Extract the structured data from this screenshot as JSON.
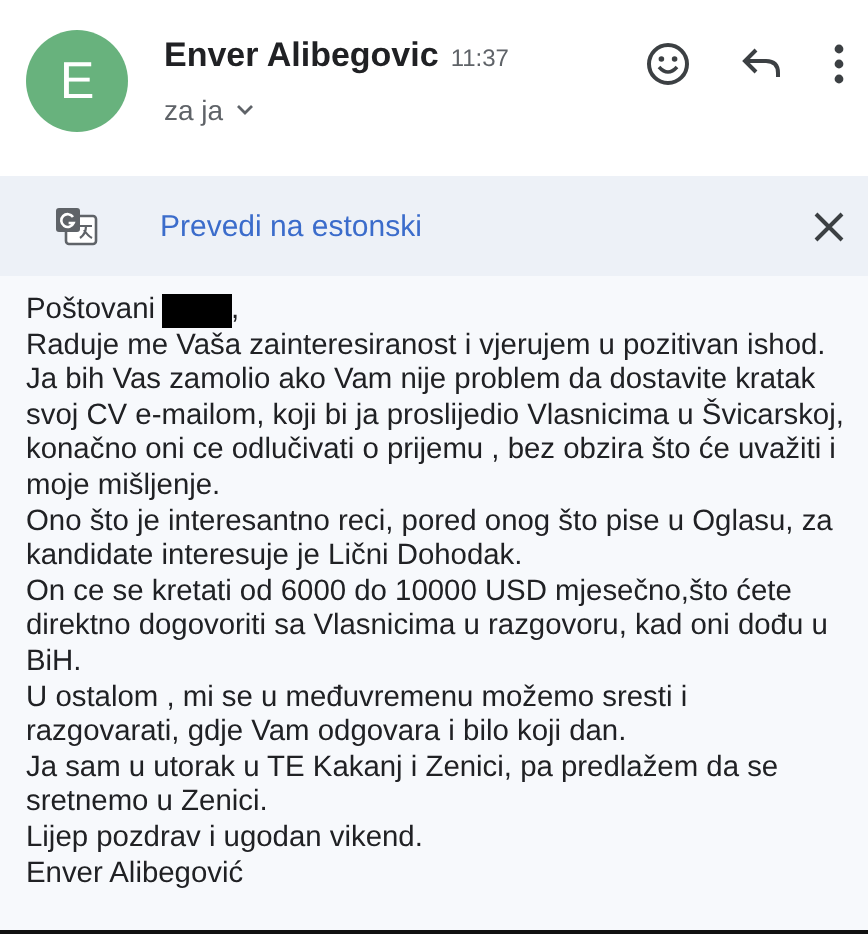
{
  "header": {
    "avatar_letter": "E",
    "sender": "Enver Alibegovic",
    "time": "11:37",
    "recipient": "za ja"
  },
  "translate_bar": {
    "label": "Prevedi na estonski"
  },
  "body": {
    "greeting": "Poštovani",
    "greeting_end": ",",
    "paragraphs": [
      "Raduje me Vaša zainteresiranost i vjerujem u pozitivan ishod.",
      "Ja bih Vas zamolio ako Vam nije problem da dostavite kratak svoj CV e-mailom, koji bi ja proslijedio Vlasnicima u Švicarskoj, konačno oni ce odlučivati o prijemu , bez obzira što će uvažiti i moje mišljenje.",
      "Ono što je interesantno reci, pored onog što pise u Oglasu, za kandidate interesuje je Lični Dohodak.",
      "On ce se kretati od 6000 do 10000 USD mjesečno,što ćete direktno dogovoriti sa Vlasnicima u razgovoru, kad oni dođu u BiH.",
      "U ostalom , mi se u međuvremenu možemo sresti i razgovarati, gdje Vam odgovara i bilo koji dan.",
      "Ja sam u utorak u TE Kakanj i Zenici, pa predlažem da se sretnemo u Zenici.",
      "Lijep pozdrav i ugodan vikend.",
      "Enver Alibegović"
    ]
  }
}
